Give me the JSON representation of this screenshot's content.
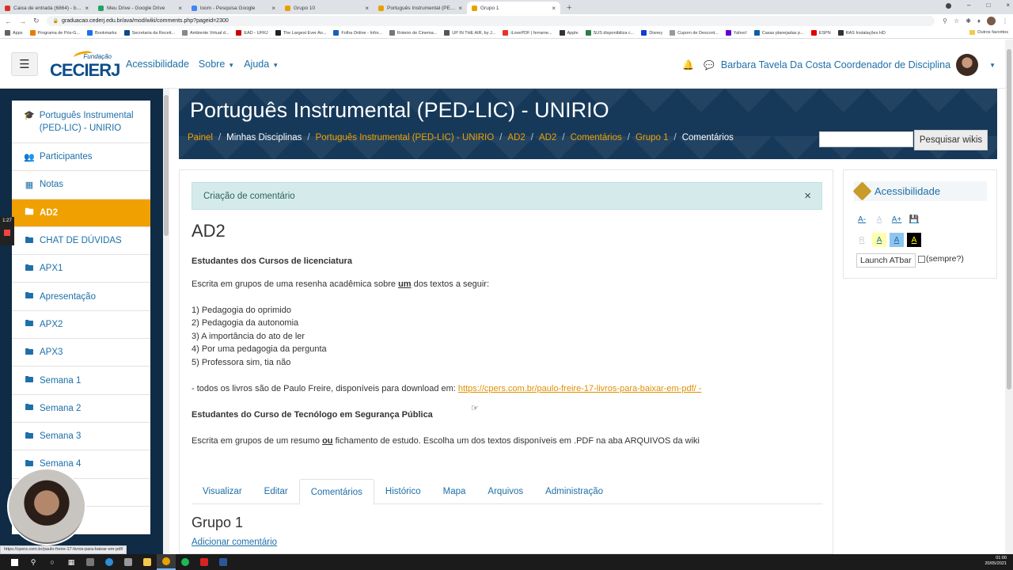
{
  "browser": {
    "tabs": [
      {
        "title": "Caixa de entrada (6864) - btavel",
        "color": "#d93025"
      },
      {
        "title": "Meu Drive - Google Drive",
        "color": "#1fa463"
      },
      {
        "title": "loom - Pesquisa Google",
        "color": "#4285f4"
      },
      {
        "title": "Grupo 10",
        "color": "#e8a200"
      },
      {
        "title": "Português Instrumental (PED-LIC)",
        "color": "#e8a200"
      },
      {
        "title": "Grupo 1",
        "color": "#e8a200"
      }
    ],
    "url": "graduacao.cederj.edu.br/ava/mod/wiki/comments.php?pageid=2300",
    "bookmarks": [
      {
        "label": "Apps",
        "color": "#5f6368"
      },
      {
        "label": "Programa de Pós-G...",
        "color": "#e67c00"
      },
      {
        "label": "Bookmarks",
        "color": "#1a73e8"
      },
      {
        "label": "Secretaria da Receit...",
        "color": "#0b4a8b"
      },
      {
        "label": "Ambiente Virtual d...",
        "color": "#888"
      },
      {
        "label": "EAD - UFRJ",
        "color": "#c00"
      },
      {
        "label": "The Largest Ever An...",
        "color": "#222"
      },
      {
        "label": "Folha Online - Infor...",
        "color": "#1a5fb4"
      },
      {
        "label": "Roteiro de Cinema...",
        "color": "#777"
      },
      {
        "label": "UP IN THE AIR, by J...",
        "color": "#555"
      },
      {
        "label": "iLovePDF | ferrame...",
        "color": "#e5322d"
      },
      {
        "label": "Apple",
        "color": "#333"
      },
      {
        "label": "SUS disponibiliza c...",
        "color": "#2d7d46"
      },
      {
        "label": "Disney",
        "color": "#113ccf"
      },
      {
        "label": "Cupom de Descont...",
        "color": "#999"
      },
      {
        "label": "Yahoo!",
        "color": "#6001d2"
      },
      {
        "label": "Casas planejadas p...",
        "color": "#0b5cad"
      },
      {
        "label": "ESPN",
        "color": "#d00"
      },
      {
        "label": "RAS Instalações HD",
        "color": "#333"
      }
    ],
    "bookmarks_other": "Outros favoritos"
  },
  "navbar": {
    "logo_top": "Fundação",
    "logo_main": "CECIERJ",
    "links": [
      "Acessibilidade",
      "Sobre",
      "Ajuda"
    ],
    "user_name": "Barbara Tavela Da Costa Coordenador de Disciplina"
  },
  "drawer": {
    "items": [
      {
        "label": "Português Instrumental (PED-LIC) - UNIRIO",
        "icon": "graduation-cap-icon"
      },
      {
        "label": "Participantes",
        "icon": "users-icon"
      },
      {
        "label": "Notas",
        "icon": "table-icon"
      },
      {
        "label": "AD2",
        "icon": "folder-icon"
      },
      {
        "label": "CHAT DE DÚVIDAS",
        "icon": "folder-icon"
      },
      {
        "label": "APX1",
        "icon": "folder-icon"
      },
      {
        "label": "Apresentação",
        "icon": "folder-icon"
      },
      {
        "label": "APX2",
        "icon": "folder-icon"
      },
      {
        "label": "APX3",
        "icon": "folder-icon"
      },
      {
        "label": "Semana 1",
        "icon": "folder-icon"
      },
      {
        "label": "Semana 2",
        "icon": "folder-icon"
      },
      {
        "label": "Semana 3",
        "icon": "folder-icon"
      },
      {
        "label": "Semana 4",
        "icon": "folder-icon"
      },
      {
        "label": "",
        "icon": "folder-icon"
      },
      {
        "label": "",
        "icon": "folder-icon"
      }
    ],
    "active_index": 3,
    "recorder_time": "1:27"
  },
  "header": {
    "title": "Português Instrumental (PED-LIC) - UNIRIO",
    "breadcrumb": [
      "Painel",
      "Minhas Disciplinas",
      "Português Instrumental (PED-LIC) - UNIRIO",
      "AD2",
      "AD2",
      "Comentários",
      "Grupo 1",
      "Comentários"
    ],
    "search_button": "Pesquisar wikis"
  },
  "main": {
    "alert": "Criação de comentário",
    "heading": "AD2",
    "lic_title": "Estudantes dos Cursos de licenciatura",
    "lic_intro_pre": "Escrita em grupos de uma resenha acadêmica sobre ",
    "lic_intro_em": "um",
    "lic_intro_post": " dos textos a seguir:",
    "books": [
      "1) Pedagogia do oprimido",
      "2) Pedagogia da autonomia",
      "3) A importância do ato de ler",
      "4) Por uma pedagogia da pergunta",
      "5) Professora sim, tia não"
    ],
    "download_text": "- todos os livros são de Paulo Freire, disponíveis para download em: ",
    "download_link": "https://cpers.com.br/paulo-freire-17-livros-para-baixar-em-pdf/ -",
    "tec_title": "Estudantes do Curso de Tecnólogo em Segurança Pública",
    "tec_pre": "Escrita em grupos de um resumo ",
    "tec_em": "ou",
    "tec_post": " fichamento de estudo. Escolha um dos textos disponíveis em .PDF na aba ARQUIVOS da wiki",
    "tabs": [
      "Visualizar",
      "Editar",
      "Comentários",
      "Histórico",
      "Mapa",
      "Arquivos",
      "Administração"
    ],
    "active_tab": "Comentários",
    "group_heading": "Grupo 1",
    "add_comment": "Adicionar comentário"
  },
  "accessibility": {
    "title": "Acessibilidade",
    "launch": "Launch ATbar",
    "always": "(sempre?)"
  },
  "status_url": "https://cpers.com.br/paulo-freire-17-livros-para-baixar-em-pdf/",
  "clock": {
    "time": "01:00",
    "date": "20/05/2021"
  }
}
